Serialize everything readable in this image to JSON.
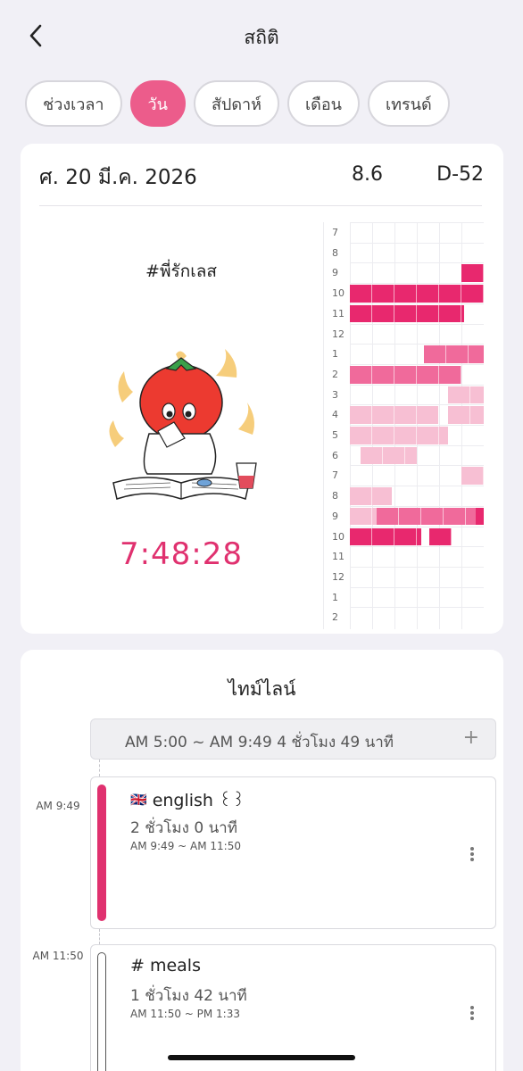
{
  "header": {
    "title": "สถิติ"
  },
  "tabs": [
    {
      "label": "ช่วงเวลา",
      "active": false
    },
    {
      "label": "วัน",
      "active": true
    },
    {
      "label": "สัปดาห์",
      "active": false
    },
    {
      "label": "เดือน",
      "active": false
    },
    {
      "label": "เทรนด์",
      "active": false
    }
  ],
  "summary": {
    "date": "ศ. 20 มี.ค. 2026",
    "hours": "8.6",
    "dday": "D-52",
    "subject_tag": "#พี่รักเลส",
    "timer": "7:48:28",
    "mascot": "tomato-studying-illustration"
  },
  "hour_grid": {
    "labels": [
      "7",
      "8",
      "9",
      "10",
      "11",
      "12",
      "1",
      "2",
      "3",
      "4",
      "5",
      "6",
      "7",
      "8",
      "9",
      "10",
      "11",
      "12",
      "1",
      "2"
    ],
    "colors": {
      "dark": "#e8286e",
      "mid": "#f06a9b",
      "light": "#f7bfd3"
    },
    "segments": [
      {
        "row": 2,
        "from": 0.83,
        "to": 1.0,
        "tone": "dark"
      },
      {
        "row": 3,
        "from": 0.0,
        "to": 1.0,
        "tone": "dark"
      },
      {
        "row": 4,
        "from": 0.0,
        "to": 0.85,
        "tone": "dark"
      },
      {
        "row": 6,
        "from": 0.55,
        "to": 1.0,
        "tone": "mid"
      },
      {
        "row": 7,
        "from": 0.0,
        "to": 0.83,
        "tone": "mid"
      },
      {
        "row": 8,
        "from": 0.73,
        "to": 1.0,
        "tone": "light"
      },
      {
        "row": 9,
        "from": 0.0,
        "to": 0.66,
        "tone": "light"
      },
      {
        "row": 9,
        "from": 0.73,
        "to": 1.0,
        "tone": "light"
      },
      {
        "row": 10,
        "from": 0.0,
        "to": 0.73,
        "tone": "light"
      },
      {
        "row": 11,
        "from": 0.08,
        "to": 0.5,
        "tone": "light"
      },
      {
        "row": 12,
        "from": 0.83,
        "to": 1.0,
        "tone": "light"
      },
      {
        "row": 13,
        "from": 0.0,
        "to": 0.31,
        "tone": "light"
      },
      {
        "row": 14,
        "from": 0.0,
        "to": 0.2,
        "tone": "light"
      },
      {
        "row": 14,
        "from": 0.2,
        "to": 0.94,
        "tone": "mid"
      },
      {
        "row": 14,
        "from": 0.94,
        "to": 1.0,
        "tone": "dark"
      },
      {
        "row": 15,
        "from": 0.0,
        "to": 0.53,
        "tone": "dark"
      },
      {
        "row": 15,
        "from": 0.59,
        "to": 0.76,
        "tone": "dark"
      }
    ]
  },
  "timeline": {
    "title": "ไทม์ไลน์",
    "gap": {
      "text": "AM 5:00 ~ AM 9:49  4 ชั่วโมง 49 นาที",
      "plus": "+"
    },
    "entries": [
      {
        "time": "AM 9:49",
        "flag": "🇬🇧",
        "title": "english ꒰꒱",
        "duration": "2 ชั่วโมง 0 นาที",
        "range": "AM 9:49 ~ AM 11:50",
        "color": "#e0316f",
        "filled": true
      },
      {
        "time": "AM 11:50",
        "flag": "",
        "title": "# meals",
        "duration": "1 ชั่วโมง 42 นาที",
        "range": "AM 11:50 ~ PM 1:33",
        "color": "#555555",
        "filled": false
      }
    ]
  }
}
